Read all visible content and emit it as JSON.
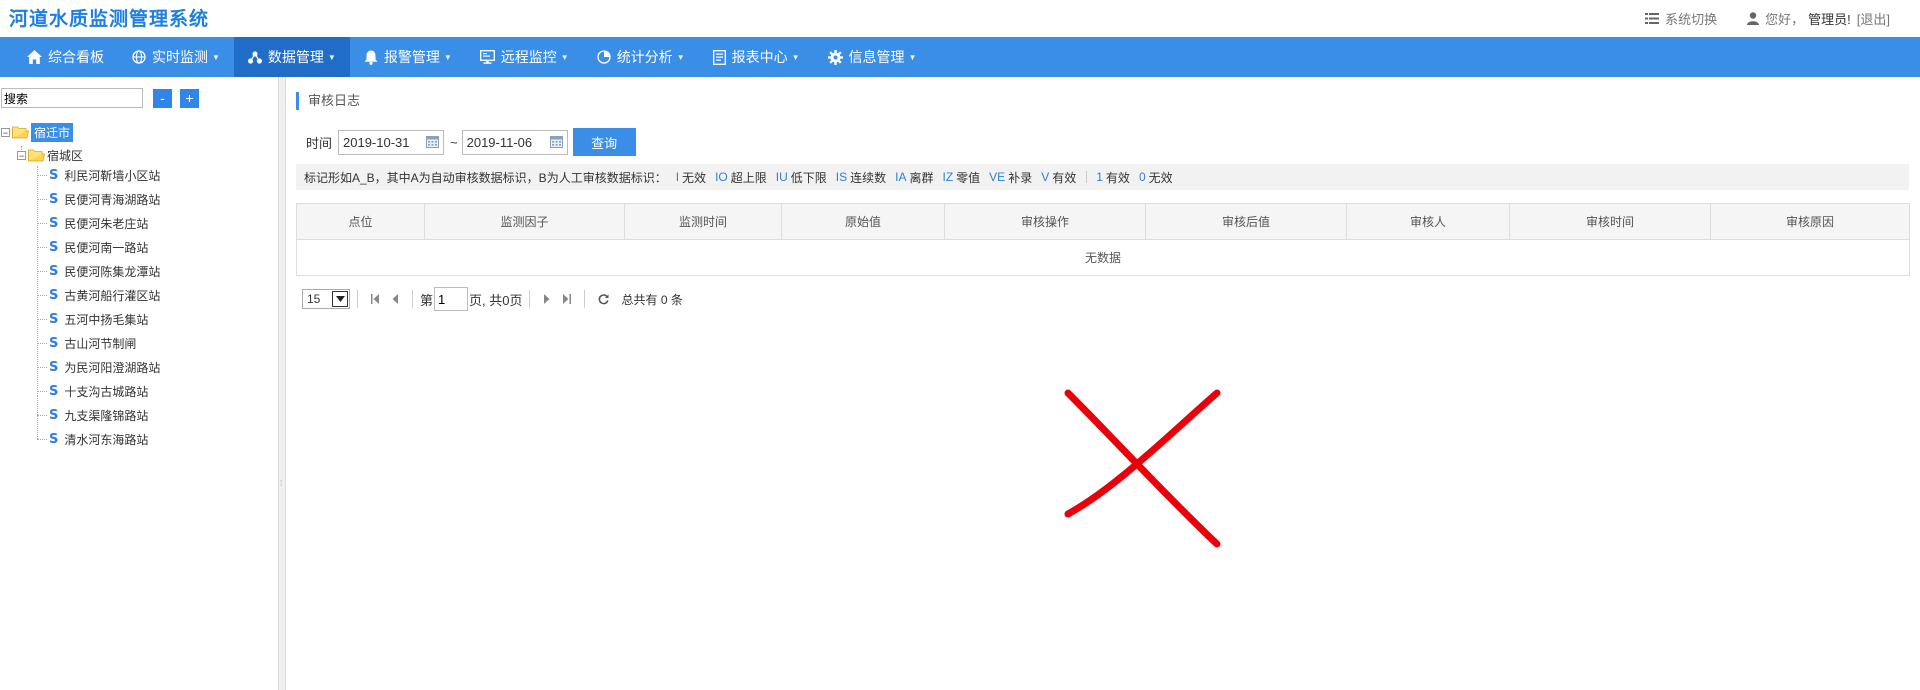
{
  "header": {
    "app_title": "河道水质监测管理系统",
    "switch_label": "系统切换",
    "greeting": "您好，",
    "user": "管理员!",
    "logout": "[退出]"
  },
  "nav": [
    {
      "label": "综合看板",
      "icon": "home-icon",
      "caret": false
    },
    {
      "label": "实时监测",
      "icon": "globe-icon",
      "caret": true
    },
    {
      "label": "数据管理",
      "icon": "share-icon",
      "caret": true,
      "active": true
    },
    {
      "label": "报警管理",
      "icon": "bell-icon",
      "caret": true
    },
    {
      "label": "远程监控",
      "icon": "monitor-icon",
      "caret": true
    },
    {
      "label": "统计分析",
      "icon": "pie-chart-icon",
      "caret": true
    },
    {
      "label": "报表中心",
      "icon": "report-icon",
      "caret": true
    },
    {
      "label": "信息管理",
      "icon": "gear-icon",
      "caret": true
    }
  ],
  "sidebar": {
    "search_value": "搜索",
    "collapse_label": "-",
    "expand_label": "+",
    "root": "宿迁市",
    "district": "宿城区",
    "stations": [
      "利民河靳墙小区站",
      "民便河青海湖路站",
      "民便河朱老庄站",
      "民便河南一路站",
      "民便河陈集龙潭站",
      "古黄河船行灌区站",
      "五河中扬毛集站",
      "古山河节制闸",
      "为民河阳澄湖路站",
      "十支沟古城路站",
      "九支渠隆锦路站",
      "清水河东海路站"
    ],
    "station_icon_text": "S"
  },
  "main": {
    "breadcrumb": "审核日志",
    "filter": {
      "time_label": "时间",
      "start_date": "2019-10-31",
      "end_date": "2019-11-06",
      "separator": "~",
      "query_label": "查询"
    },
    "legend": {
      "intro": "标记形如A_B，其中A为自动审核数据标识，B为人工审核数据标识：",
      "codes": [
        {
          "code": "I",
          "text": "无效"
        },
        {
          "code": "IO",
          "text": "超上限"
        },
        {
          "code": "IU",
          "text": "低下限"
        },
        {
          "code": "IS",
          "text": "连续数"
        },
        {
          "code": "IA",
          "text": "离群"
        },
        {
          "code": "IZ",
          "text": "零值"
        },
        {
          "code": "VE",
          "text": "补录"
        },
        {
          "code": "V",
          "text": "有效"
        }
      ],
      "codes2": [
        {
          "code": "1",
          "text": "有效"
        },
        {
          "code": "0",
          "text": "无效"
        }
      ]
    },
    "table": {
      "columns": [
        "点位",
        "监测因子",
        "监测时间",
        "原始值",
        "审核操作",
        "审核后值",
        "审核人",
        "审核时间",
        "审核原因"
      ],
      "empty_text": "无数据"
    },
    "pager": {
      "page_size": "15",
      "page_prefix": "第",
      "current_page": "1",
      "page_suffix": "页, 共0页",
      "total_text": "总共有 0 条"
    },
    "overlay_color": "#e8000a"
  },
  "colors": {
    "nav_bg": "#3a8ee6",
    "nav_active": "#1f6dc7",
    "title": "#1e7fe0"
  }
}
